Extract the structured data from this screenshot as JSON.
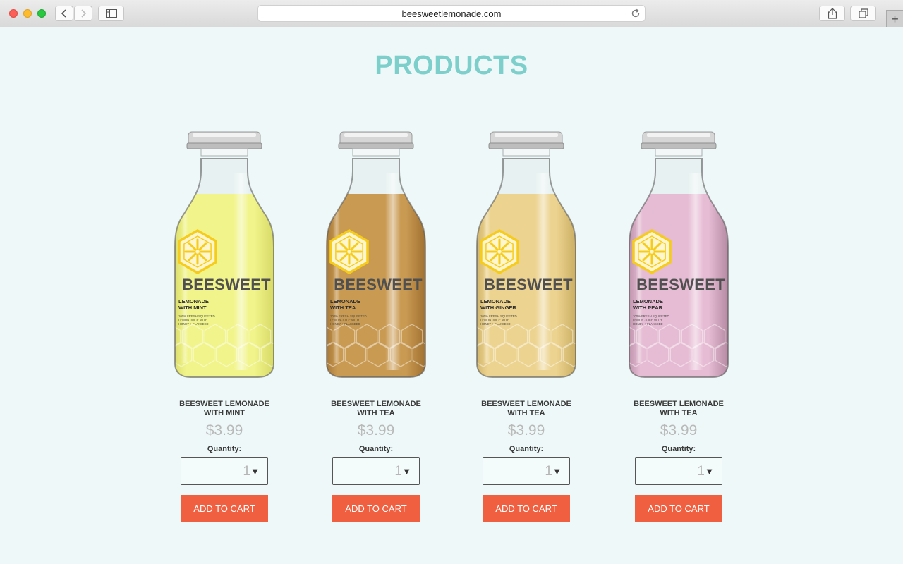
{
  "browser": {
    "url": "beesweetlemonade.com"
  },
  "page": {
    "title": "PRODUCTS",
    "quantity_label": "Quantity:",
    "add_to_cart_label": "ADD TO CART"
  },
  "products": [
    {
      "name": "BEESWEET LEMONADE\nWITH MINT",
      "price": "$3.99",
      "quantity": "1",
      "label_brand": "BEESWEET",
      "label_flavor": "LEMONADE\nWITH MINT",
      "label_desc": "100% FRESH SQUEEZED\nLEMON JUICE WITH\nHONEY + FLAXSEED",
      "liquid_color": "#f1f48a",
      "liquid_dark": "#c9cc52"
    },
    {
      "name": "BEESWEET LEMONADE\nWITH TEA",
      "price": "$3.99",
      "quantity": "1",
      "label_brand": "BEESWEET",
      "label_flavor": "LEMONADE\nWITH TEA",
      "label_desc": "100% FRESH SQUEEZED\nLEMON JUICE WITH\nHONEY + FLAXSEED",
      "liquid_color": "#c99a52",
      "liquid_dark": "#8a5a1f"
    },
    {
      "name": "BEESWEET LEMONADE\nWITH TEA",
      "price": "$3.99",
      "quantity": "1",
      "label_brand": "BEESWEET",
      "label_flavor": "LEMONADE\nWITH GINGER",
      "label_desc": "100% FRESH SQUEEZED\nLEMON JUICE WITH\nHONEY + FLAXSEED",
      "liquid_color": "#ecd38f",
      "liquid_dark": "#b89a4c"
    },
    {
      "name": "BEESWEET LEMONADE\nWITH TEA",
      "price": "$3.99",
      "quantity": "1",
      "label_brand": "BEESWEET",
      "label_flavor": "LEMONADE\nWITH PEAR",
      "label_desc": "100% FRESH SQUEEZED\nLEMON JUICE WITH\nHONEY + FLAXSEED",
      "liquid_color": "#e6bcd4",
      "liquid_dark": "#9a6f87"
    }
  ],
  "colors": {
    "accent": "#7dcfcc",
    "button": "#f05f3f",
    "background": "#eef8f8",
    "logo": "#f6cc1c"
  }
}
